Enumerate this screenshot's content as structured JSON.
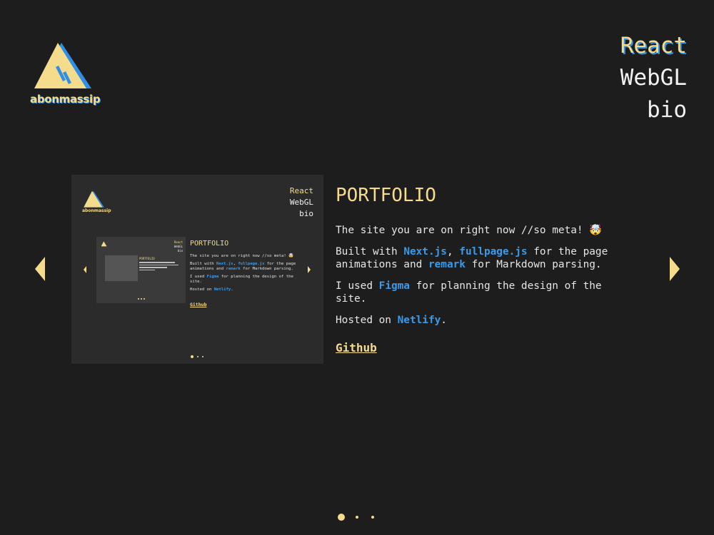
{
  "brand": {
    "name": "abonmassip"
  },
  "nav": {
    "items": [
      {
        "label": "React",
        "active": true
      },
      {
        "label": "WebGL",
        "active": false
      },
      {
        "label": "bio",
        "active": false
      }
    ]
  },
  "slide": {
    "title": "PORTFOLIO",
    "para1": "The site you are on right now //so meta! 🤯",
    "para2": {
      "prefix": "Built with ",
      "link1": "Next.js",
      "sep": ", ",
      "link2": "fullpage.js",
      "middle": " for the page animations and ",
      "link3": "remark",
      "suffix": " for Markdown parsing."
    },
    "para3": {
      "prefix": "I used ",
      "link": "Figma",
      "suffix": " for planning the design of the site."
    },
    "para4": {
      "prefix": "Hosted on ",
      "link": "Netlify",
      "suffix": "."
    },
    "github_label": "Github"
  },
  "pagination": {
    "count": 3,
    "active": 0
  },
  "colors": {
    "accent": "#f5dc8c",
    "link": "#3b9ae8",
    "background": "#1d1d1d",
    "shadow": "#2f8fe6"
  },
  "icons": {
    "prev": "triangle-left-icon",
    "next": "triangle-right-icon",
    "logo": "triangle-logo-icon"
  }
}
